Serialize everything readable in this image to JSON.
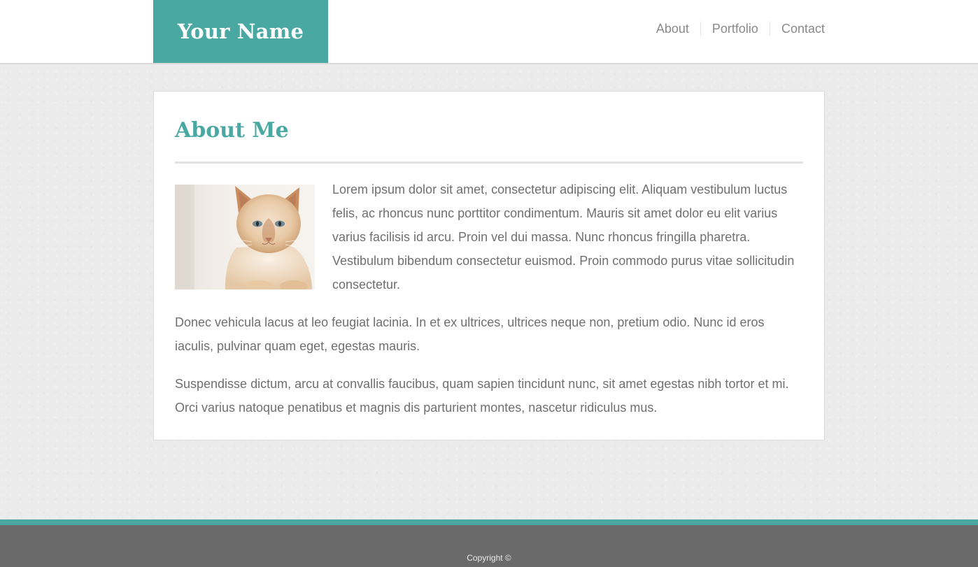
{
  "header": {
    "brand": "Your Name",
    "nav": [
      {
        "label": "About"
      },
      {
        "label": "Portfolio"
      },
      {
        "label": "Contact"
      }
    ]
  },
  "main": {
    "title": "About Me",
    "photo_alt": "cat-photo",
    "paragraphs": [
      "Lorem ipsum dolor sit amet, consectetur adipiscing elit. Aliquam vestibulum luctus felis, ac rhoncus nunc porttitor condimentum. Mauris sit amet dolor eu elit varius varius facilisis id arcu. Proin vel dui massa. Nunc rhoncus fringilla pharetra. Vestibulum bibendum consectetur euismod. Proin commodo purus vitae sollicitudin consectetur.",
      "Donec vehicula lacus at leo feugiat lacinia. In et ex ultrices, ultrices neque non, pretium odio. Nunc id eros iaculis, pulvinar quam eget, egestas mauris.",
      "Suspendisse dictum, arcu at convallis faucibus, quam sapien tincidunt nunc, sit amet egestas nibh tortor et mi. Orci varius natoque penatibus et magnis dis parturient montes, nascetur ridiculus mus."
    ]
  },
  "footer": {
    "copyright": "Copyright ©"
  },
  "colors": {
    "accent": "#4aa8a2",
    "footer": "#6a6a6a",
    "text": "#6f6f6f"
  }
}
